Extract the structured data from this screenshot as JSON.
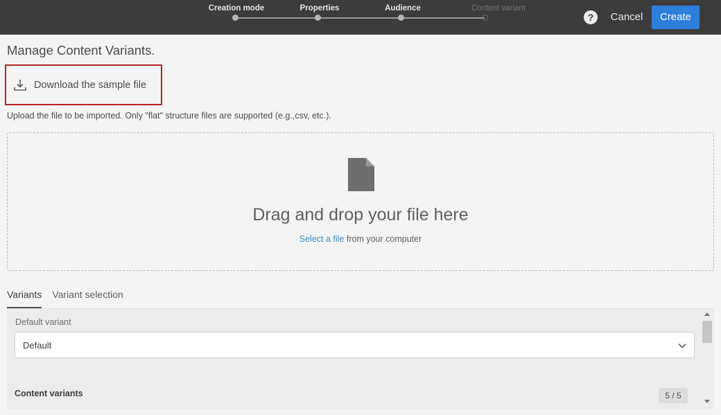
{
  "header": {
    "steps": [
      {
        "label": "Creation mode",
        "state": "done"
      },
      {
        "label": "Properties",
        "state": "done"
      },
      {
        "label": "Audience",
        "state": "done"
      },
      {
        "label": "Content variant",
        "state": "inactive"
      }
    ],
    "help_glyph": "?",
    "cancel_label": "Cancel",
    "create_label": "Create"
  },
  "page": {
    "title": "Manage Content Variants.",
    "download_label": "Download the sample file",
    "upload_hint": "Upload the file to be imported. Only \"flat\" structure files are supported (e.g.,csv, etc.)."
  },
  "dropzone": {
    "title": "Drag and drop your file here",
    "link_text": "Select a file",
    "suffix": " from your computer"
  },
  "tabs": [
    {
      "label": "Variants",
      "active": true
    },
    {
      "label": "Variant selection",
      "active": false
    }
  ],
  "panel": {
    "default_label": "Default variant",
    "default_value": "Default",
    "content_title": "Content variants",
    "count": "5 / 5"
  },
  "colors": {
    "header_bg": "#3c3c3c",
    "primary": "#2d7fdb",
    "link": "#3d86c6",
    "highlight_border": "#b22222"
  },
  "icons": {
    "help": "help-icon",
    "download": "download-icon",
    "file": "file-icon",
    "chevron": "chevron-down-icon"
  }
}
